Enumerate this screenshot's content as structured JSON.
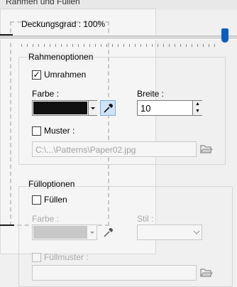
{
  "window": {
    "title": "Rahmen und Füllen"
  },
  "opacity": {
    "label": "Deckungsgrad : 100%",
    "value_percent": 100
  },
  "frame_options": {
    "heading": "Rahmenoptionen",
    "frame_checkbox": {
      "label": "Umrahmen",
      "checked": true
    },
    "color_label": "Farbe :",
    "color_value": "#101010",
    "width_label": "Breite :",
    "width_value": "10",
    "pattern_checkbox": {
      "label": "Muster :",
      "checked": false
    },
    "pattern_path": "C:\\...\\Patterns\\Paper02.jpg"
  },
  "fill_options": {
    "heading": "Fülloptionen",
    "fill_checkbox": {
      "label": "Füllen",
      "checked": false
    },
    "color_label": "Farbe :",
    "style_label": "Stil :",
    "fill_pattern_checkbox": {
      "label": "Füllmuster :",
      "checked": false
    }
  },
  "icons": {
    "eyedropper": "eyedropper-icon",
    "folder": "folder-open-icon",
    "dropdown": "chevron-down-icon",
    "spin_up": "spin-up-icon",
    "spin_down": "spin-down-icon"
  }
}
